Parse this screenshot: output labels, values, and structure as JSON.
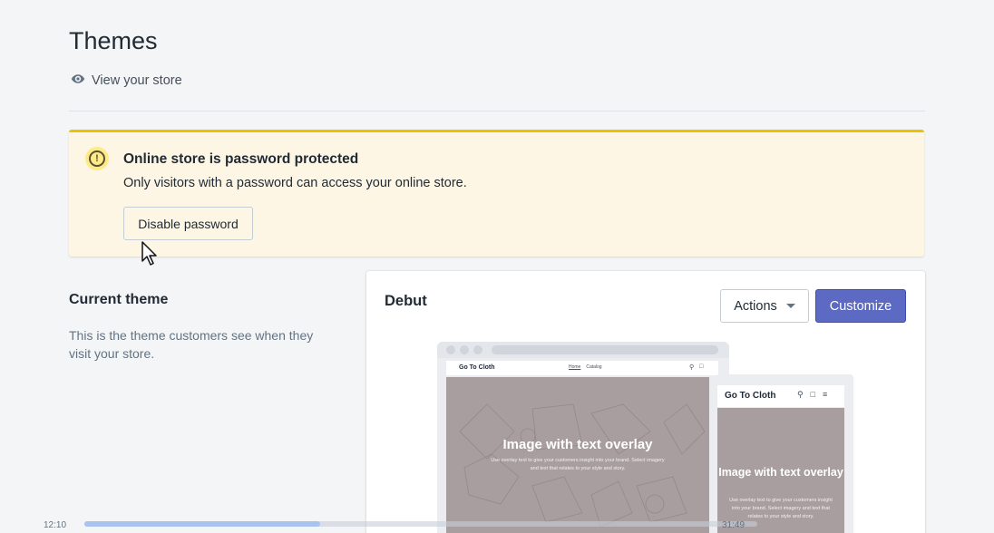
{
  "header": {
    "title": "Themes",
    "view_store_label": "View your store"
  },
  "banner": {
    "title": "Online store is password protected",
    "text": "Only visitors with a password can access your online store.",
    "button_label": "Disable password",
    "icon": "alert-circle-icon",
    "accent_color": "#eec200",
    "background_color": "#fdf6e5"
  },
  "current_theme": {
    "title": "Current theme",
    "description": "This is the theme customers see when they visit your store."
  },
  "theme_card": {
    "name": "Debut",
    "actions_label": "Actions",
    "customize_label": "Customize",
    "customize_color": "#5c6ac4",
    "desktop_preview": {
      "brand": "Go To Cloth",
      "nav_links": [
        "Home",
        "Catalog"
      ],
      "heading": "Image with text overlay",
      "subtext": "Use overlay text to give your customers insight into your brand. Select imagery and text that relates to your style and story."
    },
    "mobile_preview": {
      "brand": "Go To Cloth",
      "heading": "Image with text overlay",
      "subtext": "Use overlay text to give your customers insight into your brand. Select imagery and text that relates to your style and story."
    }
  },
  "video_player": {
    "elapsed": "12:10",
    "total": "31:49",
    "progress": 0.35
  }
}
